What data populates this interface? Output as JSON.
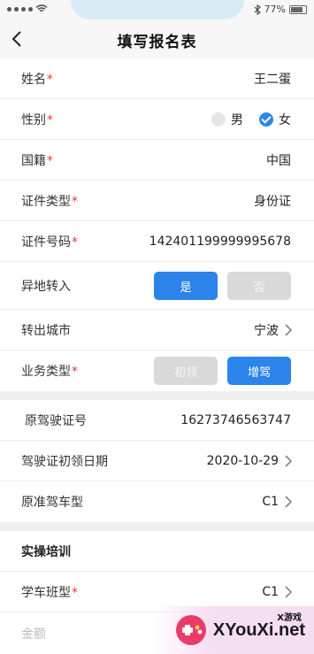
{
  "status_bar": {
    "battery_percent": "77%"
  },
  "nav": {
    "title": "填写报名表"
  },
  "form": {
    "name": {
      "label": "姓名",
      "value": "王二蛋",
      "required": true
    },
    "gender": {
      "label": "性别",
      "options": [
        "男",
        "女"
      ],
      "selected": "女",
      "required": true
    },
    "nationality": {
      "label": "国籍",
      "value": "中国",
      "required": true
    },
    "id_type": {
      "label": "证件类型",
      "value": "身份证",
      "required": true
    },
    "id_number": {
      "label": "证件号码",
      "value": "142401199999995678",
      "required": true
    },
    "transfer": {
      "label": "异地转入",
      "yes": "是",
      "no": "否",
      "selected": "是"
    },
    "from_city": {
      "label": "转出城市",
      "value": "宁波"
    },
    "business_type": {
      "label": "业务类型",
      "option_a": "初领",
      "option_b": "增驾",
      "selected": "增驾",
      "required": true
    },
    "license_no": {
      "label": "原驾驶证号",
      "value": "16273746563747"
    },
    "first_issue_date": {
      "label": "驾驶证初领日期",
      "value": "2020-10-29"
    },
    "license_class": {
      "label": "原准驾车型",
      "value": "C1"
    }
  },
  "practice": {
    "title": "实操培训",
    "class_type": {
      "label": "学车班型",
      "value": "C1",
      "required": true
    },
    "amount": {
      "label": "金额"
    }
  },
  "required_mark": "*",
  "watermark": {
    "main": "XYouXi.net",
    "sub": "X游戏"
  },
  "colors": {
    "accent": "#2a84ea",
    "required": "#e23b3b",
    "disabled": "#d9d9d9"
  }
}
